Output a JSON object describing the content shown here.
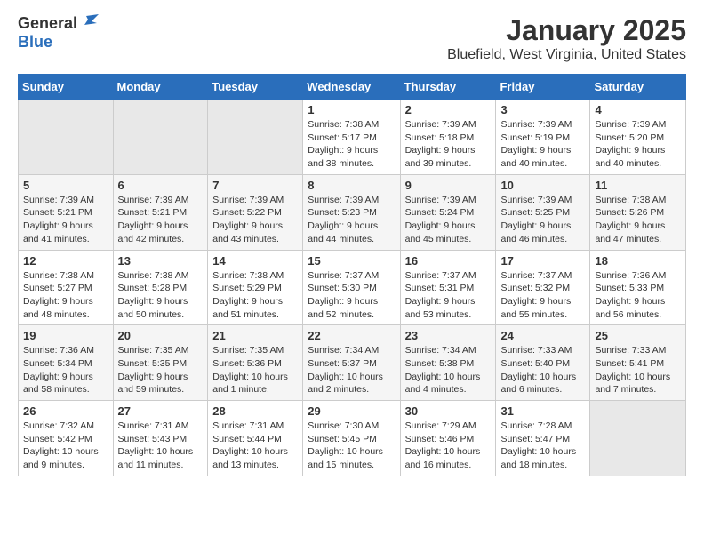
{
  "logo": {
    "general": "General",
    "blue": "Blue"
  },
  "title": {
    "main": "January 2025",
    "sub": "Bluefield, West Virginia, United States"
  },
  "days_of_week": [
    "Sunday",
    "Monday",
    "Tuesday",
    "Wednesday",
    "Thursday",
    "Friday",
    "Saturday"
  ],
  "weeks": [
    [
      {
        "day": "",
        "info": ""
      },
      {
        "day": "",
        "info": ""
      },
      {
        "day": "",
        "info": ""
      },
      {
        "day": "1",
        "info": "Sunrise: 7:38 AM\nSunset: 5:17 PM\nDaylight: 9 hours and 38 minutes."
      },
      {
        "day": "2",
        "info": "Sunrise: 7:39 AM\nSunset: 5:18 PM\nDaylight: 9 hours and 39 minutes."
      },
      {
        "day": "3",
        "info": "Sunrise: 7:39 AM\nSunset: 5:19 PM\nDaylight: 9 hours and 40 minutes."
      },
      {
        "day": "4",
        "info": "Sunrise: 7:39 AM\nSunset: 5:20 PM\nDaylight: 9 hours and 40 minutes."
      }
    ],
    [
      {
        "day": "5",
        "info": "Sunrise: 7:39 AM\nSunset: 5:21 PM\nDaylight: 9 hours and 41 minutes."
      },
      {
        "day": "6",
        "info": "Sunrise: 7:39 AM\nSunset: 5:21 PM\nDaylight: 9 hours and 42 minutes."
      },
      {
        "day": "7",
        "info": "Sunrise: 7:39 AM\nSunset: 5:22 PM\nDaylight: 9 hours and 43 minutes."
      },
      {
        "day": "8",
        "info": "Sunrise: 7:39 AM\nSunset: 5:23 PM\nDaylight: 9 hours and 44 minutes."
      },
      {
        "day": "9",
        "info": "Sunrise: 7:39 AM\nSunset: 5:24 PM\nDaylight: 9 hours and 45 minutes."
      },
      {
        "day": "10",
        "info": "Sunrise: 7:39 AM\nSunset: 5:25 PM\nDaylight: 9 hours and 46 minutes."
      },
      {
        "day": "11",
        "info": "Sunrise: 7:38 AM\nSunset: 5:26 PM\nDaylight: 9 hours and 47 minutes."
      }
    ],
    [
      {
        "day": "12",
        "info": "Sunrise: 7:38 AM\nSunset: 5:27 PM\nDaylight: 9 hours and 48 minutes."
      },
      {
        "day": "13",
        "info": "Sunrise: 7:38 AM\nSunset: 5:28 PM\nDaylight: 9 hours and 50 minutes."
      },
      {
        "day": "14",
        "info": "Sunrise: 7:38 AM\nSunset: 5:29 PM\nDaylight: 9 hours and 51 minutes."
      },
      {
        "day": "15",
        "info": "Sunrise: 7:37 AM\nSunset: 5:30 PM\nDaylight: 9 hours and 52 minutes."
      },
      {
        "day": "16",
        "info": "Sunrise: 7:37 AM\nSunset: 5:31 PM\nDaylight: 9 hours and 53 minutes."
      },
      {
        "day": "17",
        "info": "Sunrise: 7:37 AM\nSunset: 5:32 PM\nDaylight: 9 hours and 55 minutes."
      },
      {
        "day": "18",
        "info": "Sunrise: 7:36 AM\nSunset: 5:33 PM\nDaylight: 9 hours and 56 minutes."
      }
    ],
    [
      {
        "day": "19",
        "info": "Sunrise: 7:36 AM\nSunset: 5:34 PM\nDaylight: 9 hours and 58 minutes."
      },
      {
        "day": "20",
        "info": "Sunrise: 7:35 AM\nSunset: 5:35 PM\nDaylight: 9 hours and 59 minutes."
      },
      {
        "day": "21",
        "info": "Sunrise: 7:35 AM\nSunset: 5:36 PM\nDaylight: 10 hours and 1 minute."
      },
      {
        "day": "22",
        "info": "Sunrise: 7:34 AM\nSunset: 5:37 PM\nDaylight: 10 hours and 2 minutes."
      },
      {
        "day": "23",
        "info": "Sunrise: 7:34 AM\nSunset: 5:38 PM\nDaylight: 10 hours and 4 minutes."
      },
      {
        "day": "24",
        "info": "Sunrise: 7:33 AM\nSunset: 5:40 PM\nDaylight: 10 hours and 6 minutes."
      },
      {
        "day": "25",
        "info": "Sunrise: 7:33 AM\nSunset: 5:41 PM\nDaylight: 10 hours and 7 minutes."
      }
    ],
    [
      {
        "day": "26",
        "info": "Sunrise: 7:32 AM\nSunset: 5:42 PM\nDaylight: 10 hours and 9 minutes."
      },
      {
        "day": "27",
        "info": "Sunrise: 7:31 AM\nSunset: 5:43 PM\nDaylight: 10 hours and 11 minutes."
      },
      {
        "day": "28",
        "info": "Sunrise: 7:31 AM\nSunset: 5:44 PM\nDaylight: 10 hours and 13 minutes."
      },
      {
        "day": "29",
        "info": "Sunrise: 7:30 AM\nSunset: 5:45 PM\nDaylight: 10 hours and 15 minutes."
      },
      {
        "day": "30",
        "info": "Sunrise: 7:29 AM\nSunset: 5:46 PM\nDaylight: 10 hours and 16 minutes."
      },
      {
        "day": "31",
        "info": "Sunrise: 7:28 AM\nSunset: 5:47 PM\nDaylight: 10 hours and 18 minutes."
      },
      {
        "day": "",
        "info": ""
      }
    ]
  ]
}
